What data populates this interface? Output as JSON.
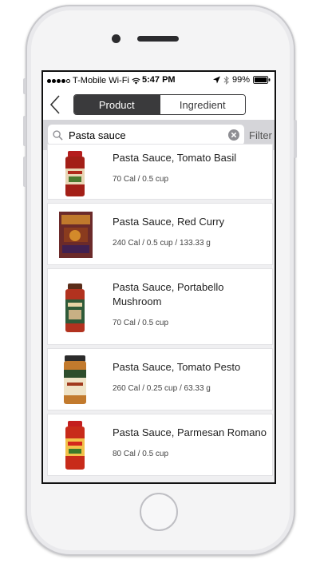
{
  "status_bar": {
    "carrier": "T-Mobile Wi-Fi",
    "time": "5:47 PM",
    "battery": "99%"
  },
  "tabs": [
    {
      "label": "Product",
      "active": true
    },
    {
      "label": "Ingredient",
      "active": false
    }
  ],
  "search": {
    "query": "Pasta sauce",
    "filter_label": "Filter"
  },
  "results": [
    {
      "name": "Pasta Sauce, Tomato Basil",
      "nutrition": "70 Cal / 0.5 cup",
      "image": "jar-red-lid"
    },
    {
      "name": "Pasta Sauce, Red Curry",
      "nutrition": "240 Cal / 0.5 cup / 133.33 g",
      "image": "box-red-curry"
    },
    {
      "name": "Pasta Sauce, Portabello Mushroom",
      "nutrition": "70 Cal / 0.5 cup",
      "image": "jar-green-label"
    },
    {
      "name": "Pasta Sauce, Tomato Pesto",
      "nutrition": "260 Cal / 0.25 cup / 63.33 g",
      "image": "jar-pesto"
    },
    {
      "name": "Pasta Sauce, Parmesan Romano",
      "nutrition": "80 Cal / 0.5 cup",
      "image": "jar-red-lid"
    }
  ]
}
